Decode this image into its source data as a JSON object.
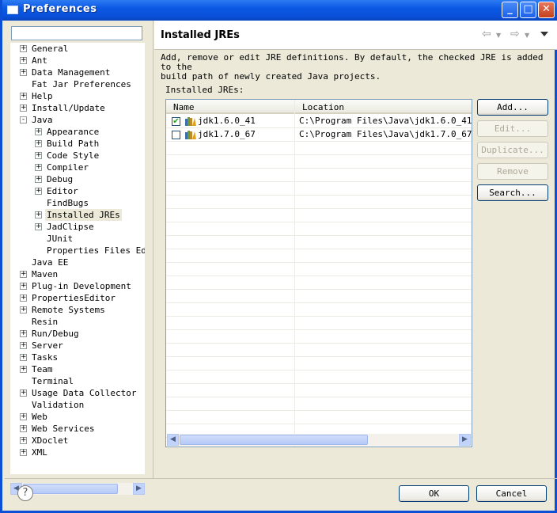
{
  "window": {
    "title": "Preferences"
  },
  "filter": {
    "value": ""
  },
  "tree": [
    {
      "label": "General",
      "level": 0,
      "expander": "+"
    },
    {
      "label": "Ant",
      "level": 0,
      "expander": "+"
    },
    {
      "label": "Data Management",
      "level": 0,
      "expander": "+"
    },
    {
      "label": "Fat Jar Preferences",
      "level": 0,
      "expander": ""
    },
    {
      "label": "Help",
      "level": 0,
      "expander": "+"
    },
    {
      "label": "Install/Update",
      "level": 0,
      "expander": "+"
    },
    {
      "label": "Java",
      "level": 0,
      "expander": "-"
    },
    {
      "label": "Appearance",
      "level": 1,
      "expander": "+"
    },
    {
      "label": "Build Path",
      "level": 1,
      "expander": "+"
    },
    {
      "label": "Code Style",
      "level": 1,
      "expander": "+"
    },
    {
      "label": "Compiler",
      "level": 1,
      "expander": "+"
    },
    {
      "label": "Debug",
      "level": 1,
      "expander": "+"
    },
    {
      "label": "Editor",
      "level": 1,
      "expander": "+"
    },
    {
      "label": "FindBugs",
      "level": 1,
      "expander": ""
    },
    {
      "label": "Installed JREs",
      "level": 1,
      "expander": "+",
      "selected": true
    },
    {
      "label": "JadClipse",
      "level": 1,
      "expander": "+"
    },
    {
      "label": "JUnit",
      "level": 1,
      "expander": ""
    },
    {
      "label": "Properties Files Edit",
      "level": 1,
      "expander": ""
    },
    {
      "label": "Java EE",
      "level": 0,
      "expander": ""
    },
    {
      "label": "Maven",
      "level": 0,
      "expander": "+"
    },
    {
      "label": "Plug-in Development",
      "level": 0,
      "expander": "+"
    },
    {
      "label": "PropertiesEditor",
      "level": 0,
      "expander": "+"
    },
    {
      "label": "Remote Systems",
      "level": 0,
      "expander": "+"
    },
    {
      "label": "Resin",
      "level": 0,
      "expander": ""
    },
    {
      "label": "Run/Debug",
      "level": 0,
      "expander": "+"
    },
    {
      "label": "Server",
      "level": 0,
      "expander": "+"
    },
    {
      "label": "Tasks",
      "level": 0,
      "expander": "+"
    },
    {
      "label": "Team",
      "level": 0,
      "expander": "+"
    },
    {
      "label": "Terminal",
      "level": 0,
      "expander": ""
    },
    {
      "label": "Usage Data Collector",
      "level": 0,
      "expander": "+"
    },
    {
      "label": "Validation",
      "level": 0,
      "expander": ""
    },
    {
      "label": "Web",
      "level": 0,
      "expander": "+"
    },
    {
      "label": "Web Services",
      "level": 0,
      "expander": "+"
    },
    {
      "label": "XDoclet",
      "level": 0,
      "expander": "+"
    },
    {
      "label": "XML",
      "level": 0,
      "expander": "+"
    }
  ],
  "page": {
    "title": "Installed JREs",
    "description_line1": "Add, remove or edit JRE definitions. By default, the checked JRE is added to the",
    "description_line2": "build path of newly created Java projects.",
    "table_label": "Installed JREs:"
  },
  "table": {
    "columns": [
      "Name",
      "Location"
    ],
    "rows": [
      {
        "name": "jdk1.6.0_41",
        "location": "C:\\Program Files\\Java\\jdk1.6.0_41",
        "checked": true
      },
      {
        "name": "jdk1.7.0_67",
        "location": "C:\\Program Files\\Java\\jdk1.7.0_67",
        "checked": false
      }
    ]
  },
  "buttons": {
    "add": "Add...",
    "edit": "Edit...",
    "duplicate": "Duplicate...",
    "remove": "Remove",
    "search": "Search...",
    "ok": "OK",
    "cancel": "Cancel"
  },
  "icons": {
    "back": "back-arrow-icon",
    "forward": "forward-arrow-icon",
    "menu": "view-menu-icon",
    "help": "help-icon",
    "jre": "jre-icon"
  },
  "colors": {
    "titlebar": "#0a50d8",
    "background": "#ece9d8",
    "selection": "#ece9d8"
  }
}
